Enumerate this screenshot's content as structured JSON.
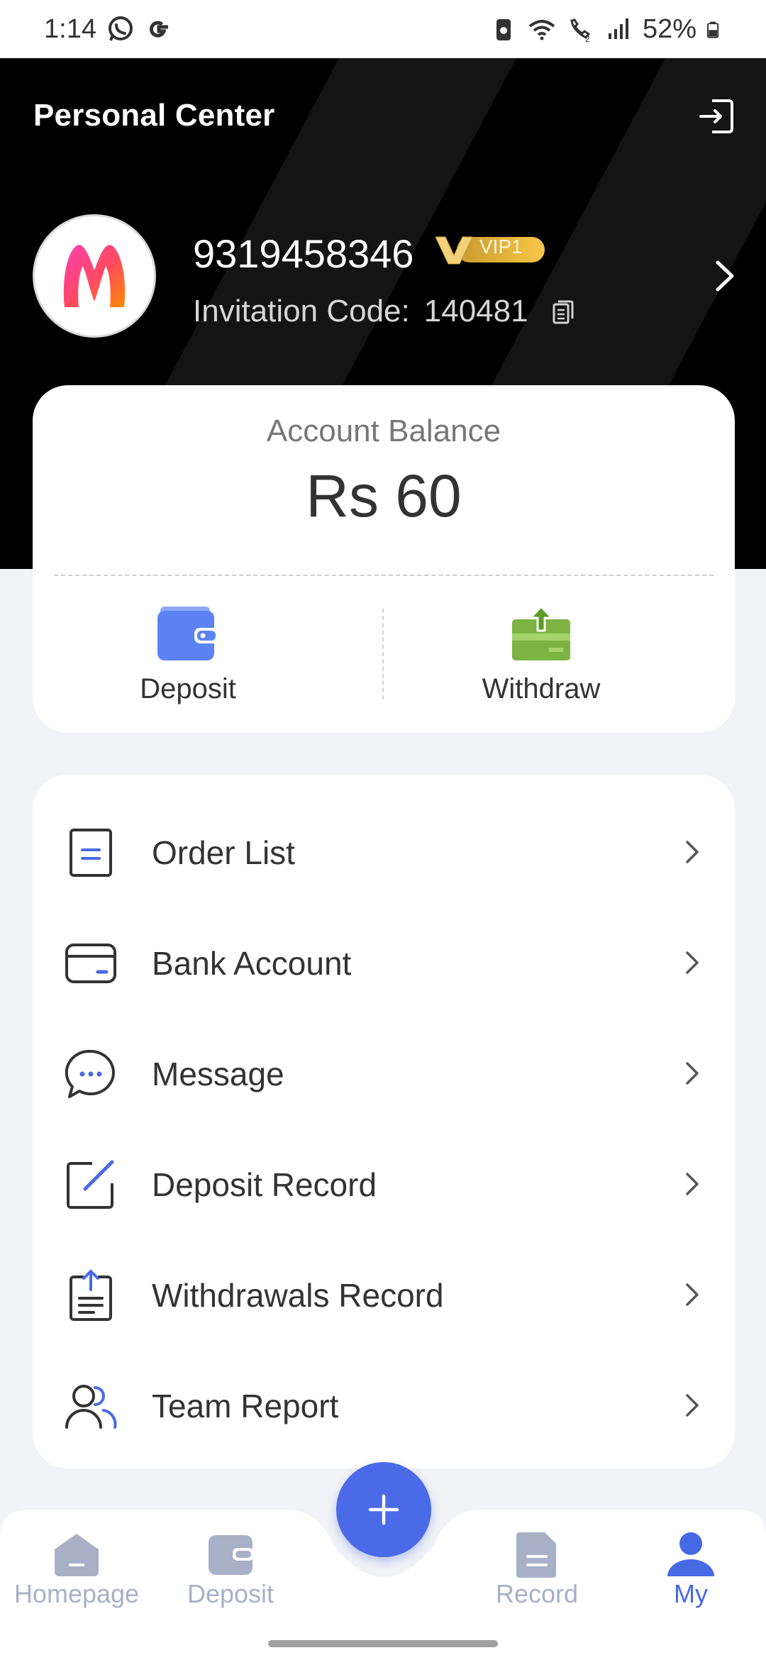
{
  "status_bar": {
    "time": "1:14",
    "battery": "52%",
    "icons": [
      "whatsapp-icon",
      "google-icon",
      "battery-saver-icon",
      "wifi-icon",
      "wifi-call-icon",
      "signal-icon",
      "battery-icon"
    ]
  },
  "header": {
    "title": "Personal Center",
    "logout_icon": "logout-icon"
  },
  "profile": {
    "username": "9319458346",
    "vip": "VIP1",
    "invite_label": "Invitation Code:",
    "invite_code": "140481"
  },
  "balance": {
    "label": "Account Balance",
    "value": "Rs 60"
  },
  "actions": {
    "deposit": "Deposit",
    "withdraw": "Withdraw"
  },
  "menu": {
    "items": [
      {
        "label": "Order List",
        "icon": "order-list-icon"
      },
      {
        "label": "Bank Account",
        "icon": "bank-card-icon"
      },
      {
        "label": "Message",
        "icon": "message-icon"
      },
      {
        "label": "Deposit Record",
        "icon": "edit-record-icon"
      },
      {
        "label": "Withdrawals Record",
        "icon": "upload-clipboard-icon"
      },
      {
        "label": "Team Report",
        "icon": "team-icon"
      }
    ]
  },
  "nav": {
    "items": [
      {
        "label": "Homepage",
        "icon": "home-icon",
        "active": false
      },
      {
        "label": "Deposit",
        "icon": "wallet-icon",
        "active": false
      },
      {
        "label": "Record",
        "icon": "document-icon",
        "active": false
      },
      {
        "label": "My",
        "icon": "user-icon",
        "active": true
      }
    ],
    "fab_icon": "plus-icon"
  },
  "colors": {
    "accent": "#4a6ae8",
    "header_bg": "#000000",
    "vip_gold": "#f1c24a",
    "withdraw_green": "#7cb342",
    "deposit_blue": "#5d82f3",
    "inactive_nav": "#a7b0c7"
  }
}
